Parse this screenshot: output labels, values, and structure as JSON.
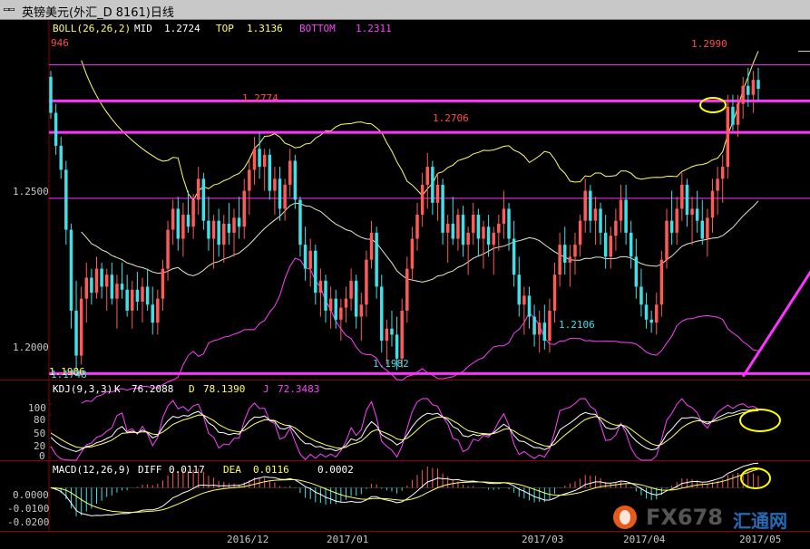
{
  "window": {
    "title": "英镑美元(外汇_D 8161)日线",
    "menu_icon": "window-menu-icon"
  },
  "main_panel": {
    "indicator_name": "BOLL(26,26,2)",
    "mid_label": "MID",
    "mid_value": "1.2724",
    "top_label": "TOP",
    "top_value": "1.3136",
    "bottom_label": "BOTTOM",
    "bottom_value": "1.2311",
    "left_cut_value": "946",
    "price_ticks": [
      "1.2500",
      "1.2000"
    ],
    "annotations": {
      "high_1": "1.2774",
      "high_2": "1.2706",
      "high_3": "1.2990",
      "low_1": "1.1982",
      "low_2": "1.2106",
      "low_3_overlap_a": "1.1986",
      "low_3_overlap_b": "1.1748"
    }
  },
  "kdj_panel": {
    "indicator_name": "KDJ(9,3,3)",
    "k_label": "K",
    "k_value": "76.2088",
    "d_label": "D",
    "d_value": "78.1390",
    "j_label": "J",
    "j_value": "72.3483",
    "ticks": [
      "100",
      "80",
      "50",
      "20",
      "0"
    ]
  },
  "macd_panel": {
    "indicator_name": "MACD(12,26,9)",
    "diff_label": "DIFF",
    "diff_value": "0.0117",
    "dea_label": "DEA",
    "dea_value": "0.0116",
    "macd_value": "0.0002",
    "ticks": [
      "0.0000",
      "-0.0100",
      "-0.0200"
    ]
  },
  "x_axis": {
    "labels": [
      "2016/12",
      "2017/01",
      "2017/03",
      "2017/04",
      "2017/05"
    ]
  },
  "watermark": {
    "brand": "FX678",
    "cn": "汇通网"
  },
  "colors": {
    "background": "#000000",
    "up_candle": "#ff5a5a",
    "down_candle": "#40e0e8",
    "boll_top_mid": "#ffff66",
    "boll_bottom": "#ff40ff",
    "drawn_lines": "#ff33ff",
    "highlight_ellipse": "#ffff00",
    "text_label": "#ff4d4d",
    "text_low": "#40e0e8"
  },
  "chart_data": {
    "type": "candlestick",
    "main": {
      "ylim": [
        1.195,
        1.315
      ],
      "ticks": [
        1.2,
        1.25
      ],
      "horizontal_levels": [
        1.3,
        1.288,
        1.2775,
        1.2555,
        1.197
      ],
      "trendline": {
        "from": {
          "bar": 136,
          "price": 1.196
        },
        "to": {
          "bar": 181,
          "price": 1.3145
        }
      },
      "candles": [
        [
          1.296,
          1.298,
          1.282,
          1.284
        ],
        [
          1.284,
          1.287,
          1.27,
          1.273
        ],
        [
          1.273,
          1.276,
          1.262,
          1.265
        ],
        [
          1.265,
          1.268,
          1.24,
          1.245
        ],
        [
          1.245,
          1.247,
          1.212,
          1.218
        ],
        [
          1.218,
          1.228,
          1.198,
          1.203
        ],
        [
          1.203,
          1.226,
          1.2,
          1.222
        ],
        [
          1.222,
          1.234,
          1.214,
          1.229
        ],
        [
          1.229,
          1.232,
          1.22,
          1.224
        ],
        [
          1.224,
          1.236,
          1.222,
          1.232
        ],
        [
          1.232,
          1.234,
          1.222,
          1.226
        ],
        [
          1.226,
          1.232,
          1.218,
          1.23
        ],
        [
          1.23,
          1.234,
          1.22,
          1.222
        ],
        [
          1.222,
          1.23,
          1.212,
          1.227
        ],
        [
          1.227,
          1.234,
          1.222,
          1.225
        ],
        [
          1.225,
          1.23,
          1.216,
          1.218
        ],
        [
          1.218,
          1.228,
          1.212,
          1.225
        ],
        [
          1.225,
          1.231,
          1.218,
          1.221
        ],
        [
          1.221,
          1.229,
          1.214,
          1.226
        ],
        [
          1.226,
          1.232,
          1.218,
          1.22
        ],
        [
          1.22,
          1.226,
          1.21,
          1.214
        ],
        [
          1.214,
          1.225,
          1.21,
          1.222
        ],
        [
          1.222,
          1.235,
          1.218,
          1.232
        ],
        [
          1.232,
          1.248,
          1.228,
          1.245
        ],
        [
          1.245,
          1.255,
          1.24,
          1.252
        ],
        [
          1.252,
          1.256,
          1.238,
          1.242
        ],
        [
          1.242,
          1.254,
          1.236,
          1.25
        ],
        [
          1.25,
          1.258,
          1.244,
          1.246
        ],
        [
          1.246,
          1.257,
          1.242,
          1.255
        ],
        [
          1.255,
          1.266,
          1.25,
          1.262
        ],
        [
          1.262,
          1.264,
          1.245,
          1.248
        ],
        [
          1.248,
          1.256,
          1.238,
          1.242
        ],
        [
          1.242,
          1.25,
          1.232,
          1.248
        ],
        [
          1.248,
          1.252,
          1.236,
          1.24
        ],
        [
          1.24,
          1.25,
          1.234,
          1.247
        ],
        [
          1.247,
          1.254,
          1.24,
          1.244
        ],
        [
          1.244,
          1.252,
          1.236,
          1.249
        ],
        [
          1.249,
          1.256,
          1.242,
          1.246
        ],
        [
          1.246,
          1.262,
          1.242,
          1.258
        ],
        [
          1.258,
          1.268,
          1.25,
          1.265
        ],
        [
          1.265,
          1.276,
          1.26,
          1.272
        ],
        [
          1.272,
          1.2774,
          1.262,
          1.266
        ],
        [
          1.266,
          1.272,
          1.258,
          1.27
        ],
        [
          1.27,
          1.272,
          1.255,
          1.258
        ],
        [
          1.258,
          1.266,
          1.25,
          1.262
        ],
        [
          1.262,
          1.266,
          1.248,
          1.252
        ],
        [
          1.252,
          1.262,
          1.248,
          1.26
        ],
        [
          1.26,
          1.272,
          1.256,
          1.268
        ],
        [
          1.268,
          1.27,
          1.252,
          1.255
        ],
        [
          1.255,
          1.256,
          1.236,
          1.24
        ],
        [
          1.24,
          1.246,
          1.228,
          1.232
        ],
        [
          1.232,
          1.242,
          1.226,
          1.238
        ],
        [
          1.238,
          1.24,
          1.22,
          1.224
        ],
        [
          1.224,
          1.232,
          1.216,
          1.228
        ],
        [
          1.228,
          1.23,
          1.214,
          1.218
        ],
        [
          1.218,
          1.226,
          1.212,
          1.222
        ],
        [
          1.222,
          1.225,
          1.212,
          1.215
        ],
        [
          1.215,
          1.222,
          1.208,
          1.219
        ],
        [
          1.219,
          1.226,
          1.214,
          1.222
        ],
        [
          1.222,
          1.232,
          1.218,
          1.228
        ],
        [
          1.228,
          1.23,
          1.212,
          1.216
        ],
        [
          1.216,
          1.224,
          1.208,
          1.22
        ],
        [
          1.22,
          1.238,
          1.216,
          1.235
        ],
        [
          1.235,
          1.248,
          1.232,
          1.244
        ],
        [
          1.244,
          1.246,
          1.222,
          1.226
        ],
        [
          1.226,
          1.23,
          1.204,
          1.208
        ],
        [
          1.208,
          1.215,
          1.2,
          1.212
        ],
        [
          1.212,
          1.218,
          1.206,
          1.21
        ],
        [
          1.21,
          1.216,
          1.1982,
          1.202
        ],
        [
          1.202,
          1.222,
          1.199,
          1.218
        ],
        [
          1.218,
          1.236,
          1.214,
          1.232
        ],
        [
          1.232,
          1.246,
          1.228,
          1.242
        ],
        [
          1.242,
          1.254,
          1.238,
          1.25
        ],
        [
          1.25,
          1.264,
          1.246,
          1.26
        ],
        [
          1.26,
          1.2706,
          1.252,
          1.266
        ],
        [
          1.266,
          1.268,
          1.25,
          1.254
        ],
        [
          1.254,
          1.264,
          1.248,
          1.26
        ],
        [
          1.26,
          1.262,
          1.24,
          1.244
        ],
        [
          1.244,
          1.25,
          1.234,
          1.247
        ],
        [
          1.247,
          1.256,
          1.24,
          1.242
        ],
        [
          1.242,
          1.252,
          1.238,
          1.25
        ],
        [
          1.25,
          1.253,
          1.236,
          1.24
        ],
        [
          1.24,
          1.246,
          1.23,
          1.244
        ],
        [
          1.244,
          1.254,
          1.24,
          1.25
        ],
        [
          1.25,
          1.252,
          1.236,
          1.242
        ],
        [
          1.242,
          1.248,
          1.232,
          1.246
        ],
        [
          1.246,
          1.25,
          1.236,
          1.24
        ],
        [
          1.24,
          1.246,
          1.23,
          1.244
        ],
        [
          1.244,
          1.25,
          1.238,
          1.247
        ],
        [
          1.247,
          1.258,
          1.242,
          1.252
        ],
        [
          1.252,
          1.254,
          1.238,
          1.242
        ],
        [
          1.242,
          1.248,
          1.226,
          1.23
        ],
        [
          1.23,
          1.236,
          1.216,
          1.22
        ],
        [
          1.22,
          1.226,
          1.21,
          1.223
        ],
        [
          1.223,
          1.226,
          1.212,
          1.216
        ],
        [
          1.216,
          1.22,
          1.206,
          1.21
        ],
        [
          1.21,
          1.218,
          1.204,
          1.214
        ],
        [
          1.214,
          1.22,
          1.205,
          1.208
        ],
        [
          1.208,
          1.222,
          1.204,
          1.218
        ],
        [
          1.218,
          1.234,
          1.214,
          1.23
        ],
        [
          1.23,
          1.244,
          1.226,
          1.24
        ],
        [
          1.24,
          1.246,
          1.23,
          1.234
        ],
        [
          1.234,
          1.24,
          1.226,
          1.236
        ],
        [
          1.236,
          1.244,
          1.23,
          1.24
        ],
        [
          1.24,
          1.25,
          1.236,
          1.248
        ],
        [
          1.248,
          1.262,
          1.244,
          1.258
        ],
        [
          1.258,
          1.26,
          1.244,
          1.248
        ],
        [
          1.248,
          1.256,
          1.24,
          1.252
        ],
        [
          1.252,
          1.254,
          1.24,
          1.244
        ],
        [
          1.244,
          1.25,
          1.232,
          1.236
        ],
        [
          1.236,
          1.246,
          1.232,
          1.243
        ],
        [
          1.243,
          1.252,
          1.238,
          1.248
        ],
        [
          1.248,
          1.26,
          1.244,
          1.255
        ],
        [
          1.255,
          1.26,
          1.24,
          1.244
        ],
        [
          1.244,
          1.248,
          1.232,
          1.236
        ],
        [
          1.236,
          1.242,
          1.222,
          1.226
        ],
        [
          1.226,
          1.232,
          1.216,
          1.22
        ],
        [
          1.22,
          1.224,
          1.212,
          1.215
        ],
        [
          1.215,
          1.218,
          1.2106,
          1.214
        ],
        [
          1.214,
          1.224,
          1.21,
          1.22
        ],
        [
          1.22,
          1.238,
          1.216,
          1.235
        ],
        [
          1.235,
          1.252,
          1.232,
          1.248
        ],
        [
          1.248,
          1.258,
          1.24,
          1.244
        ],
        [
          1.244,
          1.256,
          1.24,
          1.252
        ],
        [
          1.252,
          1.264,
          1.248,
          1.26
        ],
        [
          1.26,
          1.262,
          1.246,
          1.25
        ],
        [
          1.25,
          1.256,
          1.24,
          1.252
        ],
        [
          1.252,
          1.258,
          1.244,
          1.248
        ],
        [
          1.248,
          1.255,
          1.24,
          1.242
        ],
        [
          1.242,
          1.252,
          1.236,
          1.249
        ],
        [
          1.249,
          1.262,
          1.244,
          1.258
        ],
        [
          1.258,
          1.266,
          1.25,
          1.262
        ],
        [
          1.262,
          1.27,
          1.254,
          1.266
        ],
        [
          1.266,
          1.29,
          1.262,
          1.286
        ],
        [
          1.286,
          1.29,
          1.278,
          1.28
        ],
        [
          1.28,
          1.29,
          1.276,
          1.287
        ],
        [
          1.287,
          1.296,
          1.282,
          1.293
        ],
        [
          1.293,
          1.299,
          1.286,
          1.29
        ],
        [
          1.29,
          1.298,
          1.284,
          1.295
        ],
        [
          1.295,
          1.299,
          1.288,
          1.292
        ]
      ]
    },
    "kdj": {
      "ylim": [
        0,
        110
      ],
      "k_last": 76.2088,
      "d_last": 78.139,
      "j_last": 72.3483
    },
    "macd": {
      "ylim": [
        -0.023,
        0.006
      ],
      "diff_last": 0.0117,
      "dea_last": 0.0116,
      "macd_last": 0.0002
    }
  }
}
